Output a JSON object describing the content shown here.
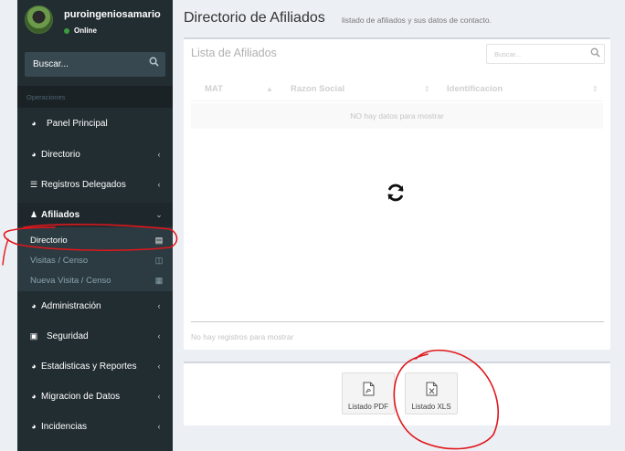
{
  "sidebar": {
    "username": "puroingeniosamario",
    "status": "Online",
    "search_placeholder": "Buscar...",
    "section_header": "Operaciones",
    "items": [
      {
        "label": "Panel Principal",
        "icon": "dashboard-icon"
      },
      {
        "label": "Directorio",
        "icon": "dashboard-icon"
      },
      {
        "label": "Registros Delegados",
        "icon": "list-icon"
      },
      {
        "label": "Afiliados",
        "icon": "users-icon"
      },
      {
        "label": "Administración",
        "icon": "dashboard-icon"
      },
      {
        "label": "Seguridad",
        "icon": "lock-icon"
      },
      {
        "label": "Estadisticas y Reportes",
        "icon": "dashboard-icon"
      },
      {
        "label": "Migracion de Datos",
        "icon": "dashboard-icon"
      },
      {
        "label": "Incidencias",
        "icon": "dashboard-icon"
      }
    ],
    "submenu": [
      {
        "label": "Directorio",
        "icon": "book-icon"
      },
      {
        "label": "Visitas / Censo",
        "icon": "folder-open-icon"
      },
      {
        "label": "Nueva Visita / Censo",
        "icon": "calendar-icon"
      }
    ]
  },
  "header": {
    "title": "Directorio de Afiliados",
    "subtitle": "listado de afiliados y sus datos de contacto."
  },
  "table": {
    "title": "Lista de Afiliados",
    "search_placeholder": "Buscar...",
    "columns": [
      "MAT",
      "Razon Social",
      "Identificacion"
    ],
    "empty_message": "NO hay datos para mostrar",
    "info": "No hay registros para mostrar"
  },
  "export": {
    "pdf_label": "Listado PDF",
    "xls_label": "Listado XLS"
  },
  "colors": {
    "sidebar_bg": "#222d32",
    "submenu_bg": "#2c3b41",
    "online": "#3c9c3c",
    "annotation": "#e0161b"
  }
}
